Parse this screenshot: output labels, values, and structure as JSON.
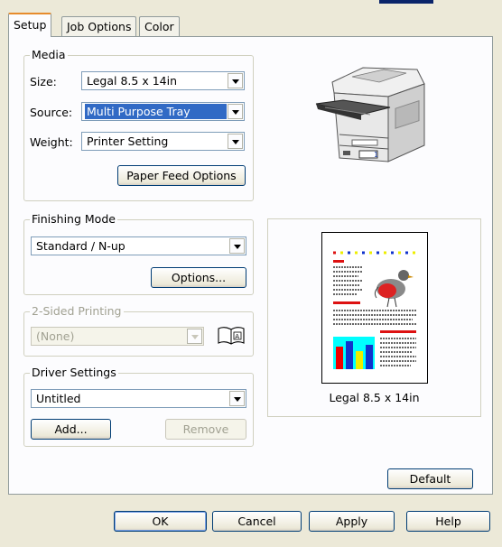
{
  "tabs": [
    {
      "label": "Setup"
    },
    {
      "label": "Job Options"
    },
    {
      "label": "Color"
    }
  ],
  "media": {
    "group_label": "Media",
    "size_label": "Size:",
    "size_value": "Legal 8.5 x 14in",
    "source_label": "Source:",
    "source_value": "Multi Purpose Tray",
    "weight_label": "Weight:",
    "weight_value": "Printer Setting",
    "paper_feed_button": "Paper Feed Options"
  },
  "finishing": {
    "group_label": "Finishing Mode",
    "mode_value": "Standard / N-up",
    "options_button": "Options..."
  },
  "two_sided": {
    "group_label": "2-Sided Printing",
    "value": "(None)",
    "enabled": false
  },
  "driver_settings": {
    "group_label": "Driver Settings",
    "value": "Untitled",
    "add_button": "Add...",
    "remove_button": "Remove"
  },
  "preview": {
    "caption": "Legal 8.5 x 14in"
  },
  "default_button": "Default",
  "footer": {
    "ok": "OK",
    "cancel": "Cancel",
    "apply": "Apply",
    "help": "Help"
  },
  "colors": {
    "accent_tab": "#e68b2c",
    "selection": "#316ac5",
    "button_border": "#003c74"
  }
}
